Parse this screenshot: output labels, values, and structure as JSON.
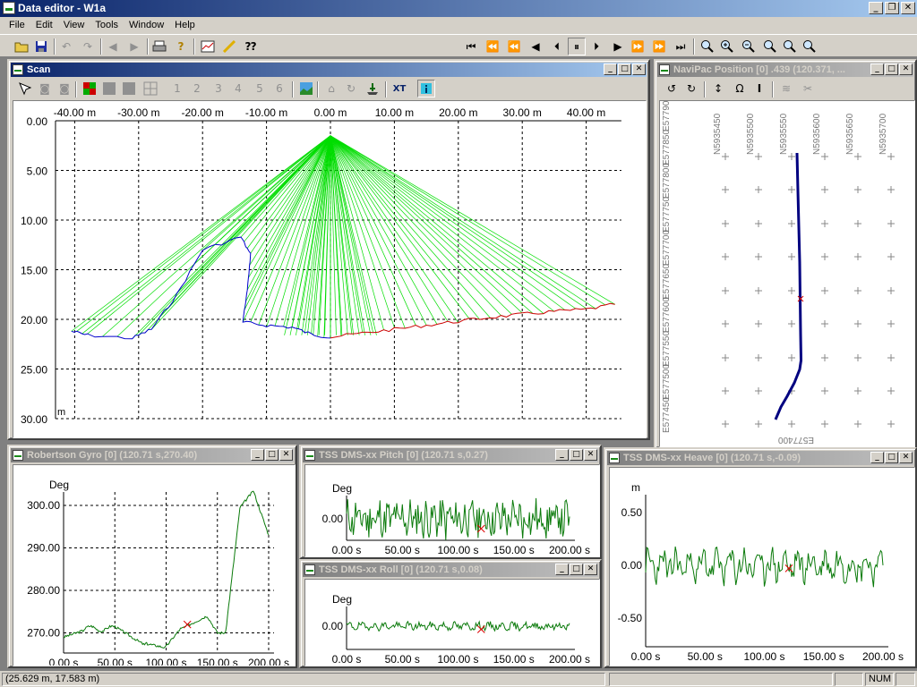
{
  "app": {
    "title": "Data editor - W1a",
    "window_buttons": [
      "_",
      "❐",
      "✕"
    ]
  },
  "menu": [
    "File",
    "Edit",
    "View",
    "Tools",
    "Window",
    "Help"
  ],
  "mdi_buttons": [
    "_",
    "□",
    "✕"
  ],
  "scan": {
    "title": "Scan",
    "toolbar_numbers": [
      "1",
      "2",
      "3",
      "4",
      "5",
      "6"
    ],
    "xt_label": "XT",
    "x_ticks": [
      {
        "v": -40,
        "label": "-40.00 m"
      },
      {
        "v": -30,
        "label": "-30.00 m"
      },
      {
        "v": -20,
        "label": "-20.00 m"
      },
      {
        "v": -10,
        "label": "-10.00 m"
      },
      {
        "v": 0,
        "label": "0.00 m"
      },
      {
        "v": 10,
        "label": "10.00 m"
      },
      {
        "v": 20,
        "label": "20.00 m"
      },
      {
        "v": 30,
        "label": "30.00 m"
      },
      {
        "v": 40,
        "label": "40.00 m"
      }
    ],
    "y_ticks": [
      {
        "v": 0,
        "label": "0.00"
      },
      {
        "v": 5,
        "label": "5.00"
      },
      {
        "v": 10,
        "label": "10.00"
      },
      {
        "v": 15,
        "label": "15.00"
      },
      {
        "v": 20,
        "label": "20.00"
      },
      {
        "v": 25,
        "label": "25.00"
      },
      {
        "v": 30,
        "label": "30.00"
      }
    ],
    "y_unit": "m",
    "colors": {
      "beams": "#00dd00",
      "left_profile": "#0000cc",
      "right_profile": "#cc0000"
    }
  },
  "navipac": {
    "title": "NaviPac Position [0]  .439 (120.371, ...",
    "north_labels": [
      "N5935450",
      "N5935500",
      "N5935550",
      "N5935600",
      "N5935650",
      "N5935700"
    ],
    "east_labels": [
      "E577900",
      "E577850",
      "E577800",
      "E577750",
      "E577700",
      "E577650",
      "E577600",
      "E577550",
      "E577500",
      "E577450"
    ],
    "bottom_label": "E577400",
    "colors": {
      "track": "#000080",
      "marker": "#cc0000"
    }
  },
  "gyro": {
    "title": "Robertson Gyro [0]  (120.71 s,270.40)",
    "ylabel": "Deg",
    "y_ticks": [
      {
        "v": 300,
        "label": "300.00"
      },
      {
        "v": 290,
        "label": "290.00"
      },
      {
        "v": 280,
        "label": "280.00"
      },
      {
        "v": 270,
        "label": "270.00"
      }
    ],
    "x_ticks": [
      {
        "v": 0,
        "label": "0.00 s"
      },
      {
        "v": 50,
        "label": "50.00 s"
      },
      {
        "v": 100,
        "label": "100.00 s"
      },
      {
        "v": 150,
        "label": "150.00 s"
      },
      {
        "v": 200,
        "label": "200.00 s"
      }
    ]
  },
  "pitch": {
    "title": "TSS DMS-xx Pitch [0]  (120.71 s,0.27)",
    "ylabel": "Deg",
    "y_ticks": [
      {
        "v": 0,
        "label": "0.00"
      }
    ],
    "x_ticks": [
      {
        "v": 0,
        "label": "0.00 s"
      },
      {
        "v": 50,
        "label": "50.00 s"
      },
      {
        "v": 100,
        "label": "100.00 s"
      },
      {
        "v": 150,
        "label": "150.00 s"
      },
      {
        "v": 200,
        "label": "200.00 s"
      }
    ]
  },
  "roll": {
    "title": "TSS DMS-xx Roll [0]  (120.71 s,0.08)",
    "ylabel": "Deg",
    "y_ticks": [
      {
        "v": 0,
        "label": "0.00"
      }
    ],
    "x_ticks": [
      {
        "v": 0,
        "label": "0.00 s"
      },
      {
        "v": 50,
        "label": "50.00 s"
      },
      {
        "v": 100,
        "label": "100.00 s"
      },
      {
        "v": 150,
        "label": "150.00 s"
      },
      {
        "v": 200,
        "label": "200.00 s"
      }
    ]
  },
  "heave": {
    "title": "TSS DMS-xx Heave [0]  (120.71 s,-0.09)",
    "ylabel": "m",
    "y_ticks": [
      {
        "v": 0.5,
        "label": "0.50"
      },
      {
        "v": 0,
        "label": "0.00"
      },
      {
        "v": -0.5,
        "label": "-0.50"
      }
    ],
    "x_ticks": [
      {
        "v": 0,
        "label": "0.00 s"
      },
      {
        "v": 50,
        "label": "50.00 s"
      },
      {
        "v": 100,
        "label": "100.00 s"
      },
      {
        "v": 150,
        "label": "150.00 s"
      },
      {
        "v": 200,
        "label": "200.00 s"
      }
    ]
  },
  "status": {
    "coords": "(25.629 m, 17.583 m)",
    "num": "NUM"
  }
}
